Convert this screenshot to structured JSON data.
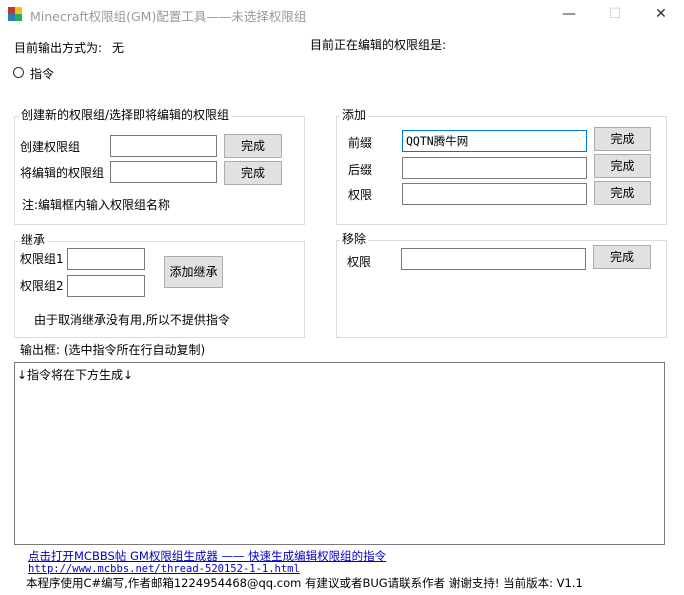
{
  "window": {
    "title": "Minecraft权限组(GM)配置工具——未选择权限组",
    "minimize_glyph": "—",
    "maximize_glyph": "☐",
    "close_glyph": "✕",
    "icon": "minecraft-app-icon"
  },
  "header": {
    "output_mode_label": "目前输出方式为:",
    "output_mode_value": "无",
    "editing_group_label": "目前正在编辑的权限组是:",
    "command_radio_label": "指令"
  },
  "create_group": {
    "title": "创建新的权限组/选择即将编辑的权限组",
    "create_label": "创建权限组",
    "create_value": "",
    "create_button": "完成",
    "edit_label": "将编辑的权限组",
    "edit_value": "",
    "edit_button": "完成",
    "note": "注:编辑框内输入权限组名称"
  },
  "add": {
    "title": "添加",
    "prefix_label": "前缀",
    "prefix_value": "QQTN腾牛网",
    "prefix_button": "完成",
    "suffix_label": "后缀",
    "suffix_value": "",
    "suffix_button": "完成",
    "perm_label": "权限",
    "perm_value": "",
    "perm_button": "完成"
  },
  "inherit": {
    "title": "继承",
    "group1_label": "权限组1",
    "group1_value": "",
    "group2_label": "权限组2",
    "group2_value": "",
    "add_button": "添加继承",
    "note": "由于取消继承没有用,所以不提供指令"
  },
  "remove": {
    "title": "移除",
    "perm_label": "权限",
    "perm_value": "",
    "button": "完成"
  },
  "output": {
    "label": "输出框: (选中指令所在行自动复制)",
    "content": "↓指令将在下方生成↓"
  },
  "footer": {
    "link_text": "点击打开MCBBS帖 GM权限组生成器 —— 快速生成编辑权限组的指令",
    "url": "http://www.mcbbs.net/thread-520152-1-1.html",
    "info": "本程序使用C#编写,作者邮箱1224954468@qq.com 有建议或者BUG请联系作者 谢谢支持! 当前版本: V1.1"
  }
}
